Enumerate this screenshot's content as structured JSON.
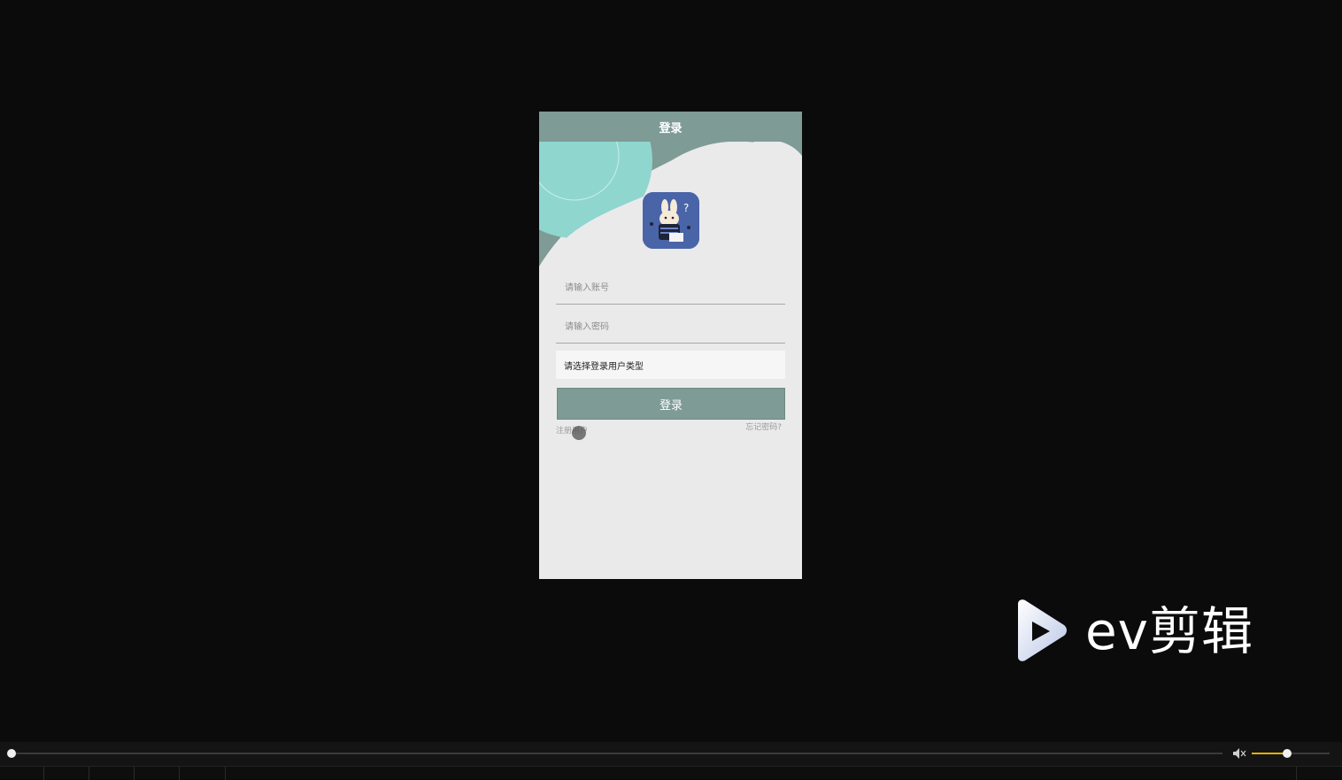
{
  "app": {
    "header_title": "登录",
    "account_placeholder": "请输入账号",
    "password_placeholder": "请输入密码",
    "usertype_select_value": "请选择登录用户类型",
    "login_button_label": "登录",
    "register_link": "注册用户",
    "forgot_link": "忘记密码?",
    "logo_icon": "rabbit-app-logo-icon",
    "colors": {
      "accent": "#7e9b95",
      "background": "#ebeaeb",
      "teal_decoration": "#8fd6cf",
      "logo_bg": "#4a64a8"
    }
  },
  "watermark": {
    "text": "ev剪辑",
    "icon": "play-triangle-icon"
  },
  "player": {
    "progress_fraction": 0.0,
    "volume_fraction": 0.45,
    "volume_icon": "speaker-icon",
    "colors": {
      "volume_fill": "#e2b100"
    }
  }
}
